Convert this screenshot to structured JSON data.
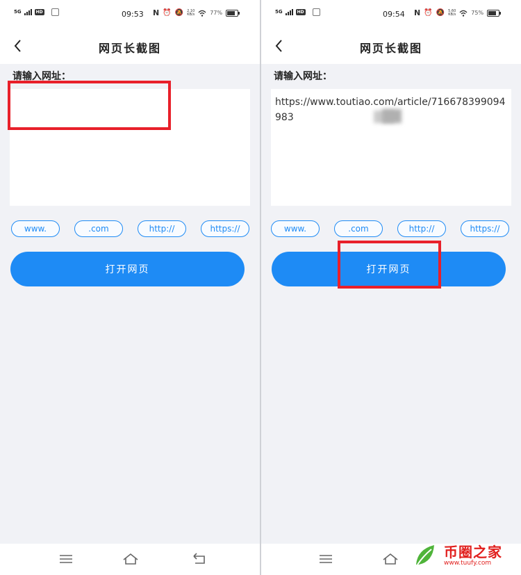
{
  "screens": [
    {
      "status": {
        "network": "5G",
        "hd": "HD",
        "time": "09:53",
        "speed": [
          "2.10",
          "KB/s"
        ],
        "battery": "77%",
        "battery_level": 0.77
      },
      "header": {
        "title": "网页长截图"
      },
      "form": {
        "prompt": "请输入网址：",
        "url_value": ""
      },
      "shortcuts": [
        "www.",
        ".com",
        "http://",
        "https://"
      ],
      "open_button": "打开网页"
    },
    {
      "status": {
        "network": "5G",
        "hd": "HD",
        "time": "09:54",
        "speed": [
          "5.60",
          "KB/s"
        ],
        "battery": "75%",
        "battery_level": 0.75
      },
      "header": {
        "title": "网页长截图"
      },
      "form": {
        "prompt": "请输入网址：",
        "url_value": "https://www.toutiao.com/article/716678399094983"
      },
      "shortcuts": [
        "www.",
        ".com",
        "http://",
        "https://"
      ],
      "open_button": "打开网页"
    }
  ],
  "icons": {
    "back": "chevron-left-icon",
    "menu": "menu-icon",
    "home": "home-icon",
    "return": "back-nav-icon"
  },
  "colors": {
    "accent": "#1e8bf5",
    "highlight": "#e8202a",
    "background": "#f1f2f6"
  },
  "watermark": {
    "title": "币圈之家",
    "url": "www.tuufy.com"
  }
}
